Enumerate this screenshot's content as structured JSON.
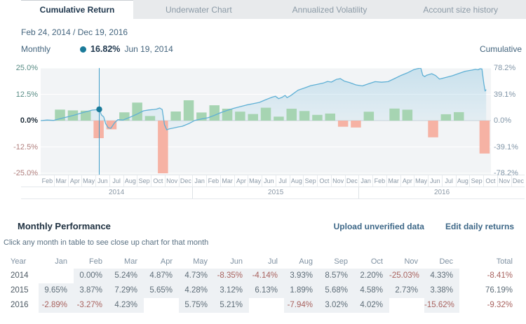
{
  "tabs": [
    {
      "label": "Cumulative Return",
      "active": true
    },
    {
      "label": "Underwater Chart",
      "active": false
    },
    {
      "label": "Annualized Volatility",
      "active": false
    },
    {
      "label": "Account size history",
      "active": false
    }
  ],
  "date_range": "Feb 24, 2014 / Dec 19, 2016",
  "legend": {
    "left_label": "Monthly",
    "tooltip_value": "16.82%",
    "tooltip_date": "Jun 19, 2014",
    "right_label": "Cumulative"
  },
  "chart_data": {
    "type": "combo-bar-area",
    "left_axis": {
      "labels": [
        "25.0%",
        "12.5%",
        "0.0%",
        "-12.5%",
        "-25.0%"
      ],
      "max": 25,
      "min": -25
    },
    "right_axis": {
      "labels": [
        "78.2%",
        "39.1%",
        "0.0%",
        "-39.1%",
        "-78.2%"
      ],
      "max": 78.2,
      "min": -78.2
    },
    "months": [
      "Feb",
      "Mar",
      "Apr",
      "May",
      "Jun",
      "Jul",
      "Aug",
      "Sep",
      "Oct",
      "Nov",
      "Dec",
      "Jan",
      "Feb",
      "Mar",
      "Apr",
      "May",
      "Jun",
      "Jul",
      "Aug",
      "Sep",
      "Oct",
      "Nov",
      "Dec",
      "Jan",
      "Feb",
      "Mar",
      "Apr",
      "May",
      "Jun",
      "Jul",
      "Aug",
      "Sep",
      "Oct",
      "Nov",
      "Dec"
    ],
    "years": [
      {
        "label": "2014",
        "months": 11
      },
      {
        "label": "2015",
        "months": 12
      },
      {
        "label": "2016",
        "months": 12
      }
    ],
    "monthly_returns": [
      0.0,
      5.24,
      4.87,
      4.73,
      -8.35,
      -4.14,
      3.93,
      8.57,
      2.2,
      -25.03,
      4.33,
      9.65,
      3.87,
      7.29,
      5.65,
      4.28,
      3.12,
      6.13,
      1.89,
      5.68,
      4.58,
      2.73,
      3.38,
      -2.89,
      -3.27,
      4.23,
      null,
      5.75,
      5.21,
      null,
      -7.94,
      3.02,
      4.02,
      null,
      -15.62
    ],
    "cumulative_line": [
      [
        0,
        0
      ],
      [
        0.5,
        0.8
      ],
      [
        1,
        0.3
      ],
      [
        1.5,
        2.8
      ],
      [
        2,
        5.2
      ],
      [
        2.6,
        8.1
      ],
      [
        3,
        10.4
      ],
      [
        3.6,
        13.6
      ],
      [
        4,
        15.6
      ],
      [
        4.3,
        16.2
      ],
      [
        4.55,
        16.82
      ],
      [
        4.72,
        8.5
      ],
      [
        4.9,
        5.5
      ],
      [
        5.05,
        -4.5
      ],
      [
        5.25,
        -10.5
      ],
      [
        5.45,
        -11.5
      ],
      [
        5.75,
        -3
      ],
      [
        6,
        1.5
      ],
      [
        6.4,
        0.8
      ],
      [
        6.8,
        4
      ],
      [
        7,
        5.5
      ],
      [
        7.5,
        9.8
      ],
      [
        8,
        14.6
      ],
      [
        8.4,
        15.9
      ],
      [
        8.8,
        16.6
      ],
      [
        9,
        17.1
      ],
      [
        9.25,
        18.8
      ],
      [
        9.45,
        16.5
      ],
      [
        9.62,
        -6
      ],
      [
        9.8,
        -13.8
      ],
      [
        10,
        -12.2
      ],
      [
        10.4,
        -10.6
      ],
      [
        10.7,
        -9.4
      ],
      [
        11,
        -8.4
      ],
      [
        11.5,
        -4.6
      ],
      [
        12,
        0.4
      ],
      [
        12.6,
        2.8
      ],
      [
        13,
        4.3
      ],
      [
        13.5,
        7.8
      ],
      [
        14,
        11.9
      ],
      [
        14.5,
        15.2
      ],
      [
        15,
        18.2
      ],
      [
        15.5,
        20.7
      ],
      [
        16,
        23.3
      ],
      [
        16.5,
        25.1
      ],
      [
        17,
        27.1
      ],
      [
        17.5,
        31.2
      ],
      [
        18,
        34.9
      ],
      [
        18.25,
        36.2
      ],
      [
        18.5,
        32.6
      ],
      [
        18.75,
        34.5
      ],
      [
        19,
        37.5
      ],
      [
        19.15,
        34.2
      ],
      [
        19.4,
        36.8
      ],
      [
        19.7,
        41
      ],
      [
        20,
        45.3
      ],
      [
        20.5,
        48.5
      ],
      [
        21,
        52
      ],
      [
        21.5,
        54
      ],
      [
        22,
        56.1
      ],
      [
        22.3,
        58.3
      ],
      [
        22.6,
        57.3
      ],
      [
        23,
        61.4
      ],
      [
        23.3,
        62.3
      ],
      [
        23.6,
        58.8
      ],
      [
        24,
        56.7
      ],
      [
        24.5,
        53.2
      ],
      [
        25,
        51.6
      ],
      [
        25.5,
        54.8
      ],
      [
        26,
        58
      ],
      [
        26.5,
        57.1
      ],
      [
        27,
        58
      ],
      [
        27.5,
        62.5
      ],
      [
        28,
        67.1
      ],
      [
        28.5,
        71
      ],
      [
        29,
        75.8
      ],
      [
        29.3,
        77.3
      ],
      [
        29.55,
        78.2
      ],
      [
        29.7,
        67.5
      ],
      [
        29.85,
        65.5
      ],
      [
        30,
        67.5
      ],
      [
        30.4,
        69.8
      ],
      [
        30.7,
        67
      ],
      [
        31,
        61.8
      ],
      [
        31.5,
        64.2
      ],
      [
        32,
        66.7
      ],
      [
        32.5,
        70.1
      ],
      [
        33,
        73.4
      ],
      [
        33.5,
        75.1
      ],
      [
        33.8,
        76.2
      ],
      [
        34,
        75.6
      ],
      [
        34.15,
        77.2
      ],
      [
        34.3,
        76.8
      ],
      [
        34.45,
        55
      ],
      [
        34.55,
        44
      ],
      [
        34.63,
        46.3
      ]
    ],
    "crosshair": {
      "m": 4.55,
      "value": 16.82
    },
    "colors": {
      "positive_bar": "#a6d4b2",
      "negative_bar": "#f6b2a4",
      "line": "#5fb0d5",
      "crosshair": "#3e9dc8",
      "dot": "#1a7a99",
      "grid": "#ffffff",
      "zero_line": "#ccd4da",
      "plot_bg": "#f2f4f6"
    }
  },
  "table": {
    "title": "Monthly Performance",
    "links": [
      "Upload unverified data",
      "Edit daily returns"
    ],
    "subtitle": "Click any month in table to see close up chart for that month",
    "columns": [
      "Year",
      "Jan",
      "Feb",
      "Mar",
      "Apr",
      "May",
      "Jun",
      "Jul",
      "Aug",
      "Sep",
      "Oct",
      "Nov",
      "Dec",
      "Total"
    ],
    "rows": [
      {
        "year": "2014",
        "values": [
          "",
          "0.00%",
          "5.24%",
          "4.87%",
          "4.73%",
          "-8.35%",
          "-4.14%",
          "3.93%",
          "8.57%",
          "2.20%",
          "-25.03%",
          "4.33%"
        ],
        "total": "-8.41%"
      },
      {
        "year": "2015",
        "values": [
          "9.65%",
          "3.87%",
          "7.29%",
          "5.65%",
          "4.28%",
          "3.12%",
          "6.13%",
          "1.89%",
          "5.68%",
          "4.58%",
          "2.73%",
          "3.38%"
        ],
        "total": "76.19%"
      },
      {
        "year": "2016",
        "values": [
          "-2.89%",
          "-3.27%",
          "4.23%",
          "",
          "5.75%",
          "5.21%",
          "",
          "-7.94%",
          "3.02%",
          "4.02%",
          "",
          "-15.62%"
        ],
        "total": "-9.32%"
      }
    ]
  }
}
